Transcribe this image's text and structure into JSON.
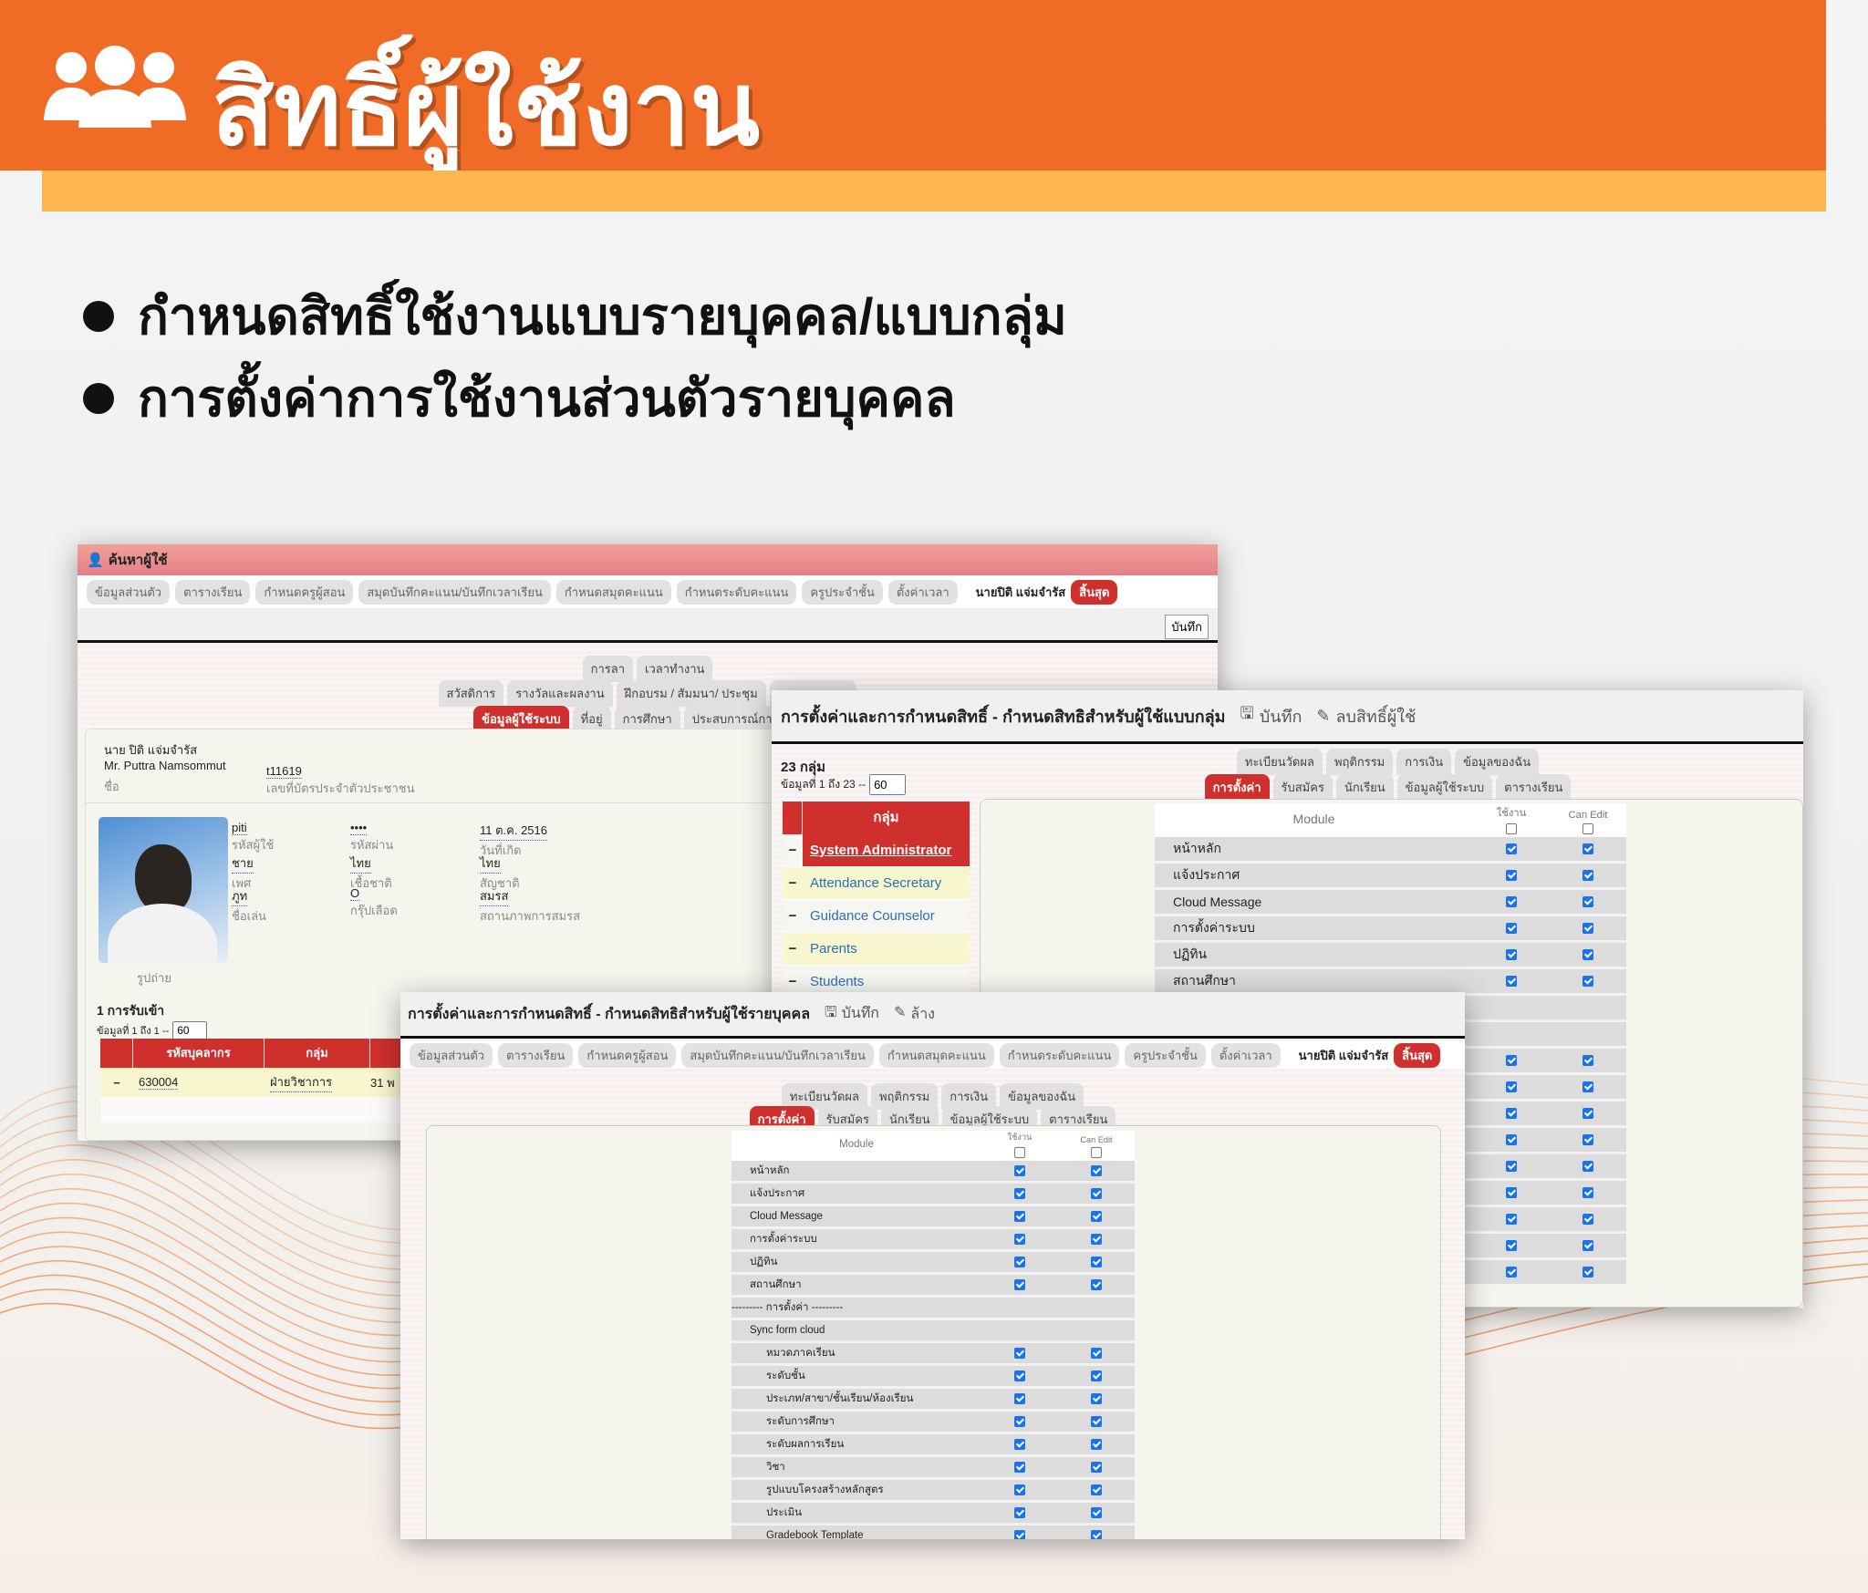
{
  "banner": {
    "title": "สิทธิ์ผู้ใช้งาน",
    "icon": "users-icon",
    "accent": "#f06c26",
    "strip": "#fdb64f"
  },
  "bullets": [
    "กำหนดสิทธิ์ใช้งานแบบรายบุคคล/แบบกลุ่ม",
    "การตั้งค่าการใช้งานส่วนตัวรายบุคคล"
  ],
  "nav": {
    "items": [
      "ข้อมูลส่วนตัว",
      "ตารางเรียน",
      "กำหนดครูผู้สอน",
      "สมุดบันทึกคะแนน/บันทึกเวลาเรียน",
      "กำหนดสมุดคะแนน",
      "กำหนดระดับคะแนน",
      "ครูประจำชั้น",
      "ตั้งค่าเวลา"
    ],
    "user": "นายปิติ แจ่มจำรัส",
    "logout": "สิ้นสุด"
  },
  "search_window": {
    "title": "ค้นหาผู้ใช้",
    "save": "บันทึก",
    "tabs_row1": [
      "การลา",
      "เวลาทำงาน"
    ],
    "tabs_row2": [
      "สวัสดิการ",
      "รางวัลและผลงาน",
      "ฝึกอบรม / สัมมนา/ ประชุม",
      "ความสามารถ"
    ],
    "tabs_row3": [
      "ข้อมูลผู้ใช้ระบบ",
      "ที่อยู่",
      "การศึกษา",
      "ประสบการณ์การทำงาน"
    ],
    "profile": {
      "name_th": "นาย ปิติ แจ่มจำรัส",
      "name_en": "Mr. Puttra Namsommut",
      "name_label": "ชื่อ",
      "id": "t11619",
      "id_label": "เลขที่บัตรประจำตัวประชาชน",
      "photo_label": "รูปถ่าย",
      "fields": [
        {
          "value": "piti",
          "label": "รหัสผู้ใช้"
        },
        {
          "value": "••••",
          "label": "รหัสผ่าน"
        },
        {
          "value": "11 ต.ค. 2516",
          "label": "วันที่เกิด"
        },
        {
          "value": "ชาย",
          "label": "เพศ"
        },
        {
          "value": "ไทย",
          "label": "เชื้อชาติ"
        },
        {
          "value": "ไทย",
          "label": "สัญชาติ"
        },
        {
          "value": "ภูท",
          "label": "ชื่อเล่น"
        },
        {
          "value": "O",
          "label": "กรุ๊ปเลือด"
        },
        {
          "value": "สมรส",
          "label": "สถานภาพการสมรส"
        }
      ]
    },
    "admissions": {
      "count": "1 การรับเข้า",
      "range": "ข้อมูลที่ 1 ถึง 1 --",
      "page_size": "60",
      "headers": [
        "รหัสบุคลากร",
        "กลุ่ม"
      ],
      "rows": [
        {
          "code": "630004",
          "group": "ฝ่ายวิชาการ",
          "date": "31 พ"
        }
      ]
    }
  },
  "group_window": {
    "title": "การตั้งค่าและการกำหนดสิทธิ์ - กำหนดสิทธิสำหรับผู้ใช้แบบกลุ่ม",
    "save": "บันทึก",
    "remove": "ลบสิทธิ์ผู้ใช้",
    "count": "23 กลุ่ม",
    "range": "ข้อมูลที่ 1 ถึง 23 --",
    "page_size": "60",
    "group_header": "กลุ่ม",
    "groups": [
      "System Administrator",
      "Attendance Secretary",
      "Guidance Counselor",
      "Parents",
      "Students"
    ],
    "selected_group": "System Administrator"
  },
  "indiv_window": {
    "title": "การตั้งค่าและการกำหนดสิทธิ์ - กำหนดสิทธิสำหรับผู้ใช้รายบุคคล",
    "save": "บันทึก",
    "clear": "ล้าง"
  },
  "perm_tabs": {
    "row1": [
      "ทะเบียนวัดผล",
      "พฤติกรรม",
      "การเงิน",
      "ข้อมูลของฉัน"
    ],
    "row2": [
      "การตั้งค่า",
      "รับสมัคร",
      "นักเรียน",
      "ข้อมูลผู้ใช้ระบบ",
      "ตารางเรียน"
    ],
    "active": "การตั้งค่า"
  },
  "modules": {
    "header": {
      "module": "Module",
      "use": "ใช้งาน",
      "edit": "Can Edit",
      "use_all": false,
      "edit_all": false
    },
    "rows": [
      {
        "label": "หน้าหลัก",
        "use": true,
        "edit": true
      },
      {
        "label": "แจ้งประกาศ",
        "use": true,
        "edit": true
      },
      {
        "label": "Cloud Message",
        "use": true,
        "edit": true
      },
      {
        "label": "การตั้งค่าระบบ",
        "use": true,
        "edit": true
      },
      {
        "label": "ปฏิทิน",
        "use": true,
        "edit": true
      },
      {
        "label": "สถานศึกษา",
        "use": true,
        "edit": true
      },
      {
        "label": "--------- การตั้งค่า ---------",
        "type": "separator"
      },
      {
        "label": "Sync form cloud",
        "type": "group"
      },
      {
        "label": "หมวดภาคเรียน",
        "use": true,
        "edit": true,
        "type": "sub"
      },
      {
        "label": "ระดับชั้น",
        "use": true,
        "edit": true,
        "type": "sub"
      },
      {
        "label": "ประเภท/สาขา/ชั้นเรียน/ห้องเรียน",
        "use": true,
        "edit": true,
        "type": "sub"
      },
      {
        "label": "ระดับการศึกษา",
        "use": true,
        "edit": true,
        "type": "sub"
      },
      {
        "label": "ระดับผลการเรียน",
        "use": true,
        "edit": true,
        "type": "sub"
      },
      {
        "label": "วิชา",
        "use": true,
        "edit": true,
        "type": "sub"
      },
      {
        "label": "รูปแบบโครงสร้างหลักสูตร",
        "use": true,
        "edit": true,
        "type": "sub"
      },
      {
        "label": "ประเมิน",
        "use": true,
        "edit": true,
        "type": "sub"
      },
      {
        "label": "Gradebook Template",
        "use": true,
        "edit": true,
        "type": "sub"
      }
    ]
  }
}
